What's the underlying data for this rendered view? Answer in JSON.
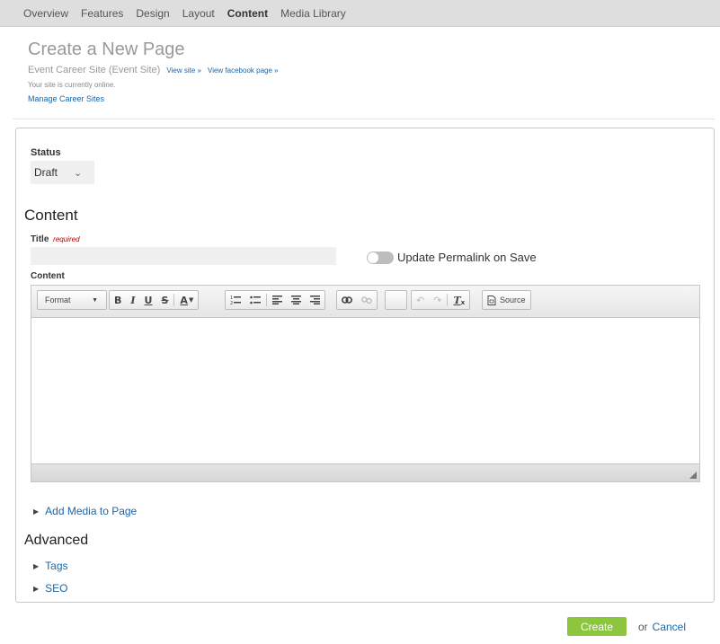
{
  "nav": {
    "items": [
      {
        "label": "Overview"
      },
      {
        "label": "Features"
      },
      {
        "label": "Design"
      },
      {
        "label": "Layout"
      },
      {
        "label": "Content"
      },
      {
        "label": "Media Library"
      }
    ],
    "active": "Content"
  },
  "header": {
    "title": "Create a New Page",
    "site_name": "Event Career Site (Event Site)",
    "view_site": "View site »",
    "view_facebook": "View facebook page »",
    "online_status": "Your site is currently online.",
    "manage_link": "Manage Career Sites"
  },
  "form": {
    "status_label": "Status",
    "status_value": "Draft",
    "content_heading": "Content",
    "title_label": "Title",
    "title_required": "required",
    "title_value": "",
    "permalink_toggle_label": "Update Permalink on Save",
    "permalink_toggle_on": false,
    "content_label": "Content"
  },
  "toolbar": {
    "format_label": "Format",
    "bold": "B",
    "italic": "I",
    "underline": "U",
    "strike": "S",
    "text_color": "A",
    "source_label": "Source"
  },
  "sections": {
    "add_media": "Add Media to Page",
    "advanced_heading": "Advanced",
    "tags": "Tags",
    "seo": "SEO"
  },
  "actions": {
    "create": "Create",
    "or": "or",
    "cancel": "Cancel"
  },
  "colors": {
    "accent_link": "#1a66a8",
    "create_button": "#8cc63f",
    "required_text": "#b30000"
  }
}
